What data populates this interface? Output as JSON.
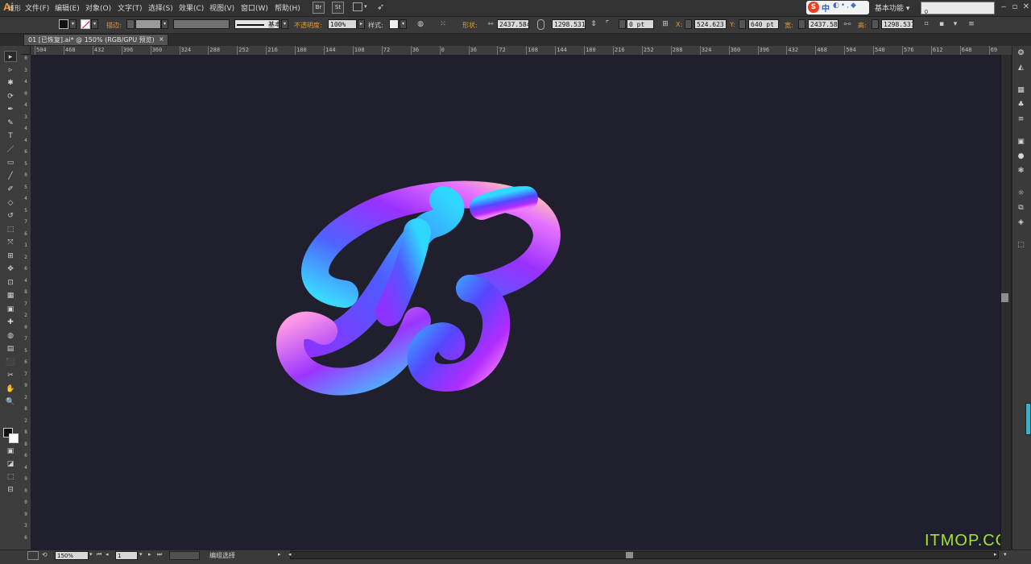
{
  "app": {
    "logo": "Ai"
  },
  "menu": [
    "文件(F)",
    "编辑(E)",
    "对象(O)",
    "文字(T)",
    "选择(S)",
    "效果(C)",
    "视图(V)",
    "窗口(W)",
    "帮助(H)"
  ],
  "menu_buttons": {
    "bridge": "Br",
    "stock": "St"
  },
  "ime": {
    "s": "S",
    "zh": "中",
    "rest": "◐•,◆"
  },
  "workspace_label": "基本功能",
  "control": {
    "object_type": "矩形",
    "stroke_label": "描边:",
    "stroke_style": "基本",
    "opacity_label": "不透明度:",
    "opacity_value": "100%",
    "style_label": "样式:",
    "shape_label": "形状:",
    "shape_w": "2437.584",
    "shape_h": "1298.531",
    "corner": "0 pt",
    "x_label": "X:",
    "x_value": "524.623",
    "y_label": "Y:",
    "y_value": "640 pt",
    "w_label": "宽:",
    "w_value": "2437.584",
    "h_label": "高:",
    "h_value": "1298.531"
  },
  "document_tab": {
    "title": "01 [已恢复].ai* @ 150% (RGB/GPU 预览)",
    "close": "×"
  },
  "ruler_h": [
    "504",
    "468",
    "432",
    "396",
    "360",
    "324",
    "288",
    "252",
    "216",
    "180",
    "144",
    "108",
    "72",
    "36",
    "0",
    "36",
    "72",
    "108",
    "144",
    "180",
    "216",
    "252",
    "288",
    "324",
    "360",
    "396",
    "432",
    "468",
    "504",
    "540",
    "576",
    "612",
    "648",
    "69"
  ],
  "ruler_v": [
    "0",
    "3",
    "4",
    "0",
    "4",
    "3",
    "4",
    "4",
    "6",
    "5",
    "0",
    "5",
    "4",
    "5",
    "7",
    "6",
    "1",
    "2",
    "6",
    "4",
    "8",
    "7",
    "2",
    "0",
    "7",
    "5",
    "6",
    "7",
    "9",
    "2",
    "8",
    "2",
    "8",
    "8",
    "6",
    "4",
    "9",
    "0",
    "0",
    "9",
    "3",
    "6"
  ],
  "tools": [
    "▸",
    "▹",
    "✱",
    "⟳",
    "✒",
    "✎",
    "T",
    "／",
    "▭",
    "╱",
    "✐",
    "◇",
    "↺",
    "⬚",
    "⤧",
    "⊞",
    "✥",
    "⊡",
    "▦",
    "▣",
    "✚",
    "◍",
    "▤",
    "⬛",
    "✂",
    "✋",
    "🔍"
  ],
  "panel_icons": [
    "❂",
    "◭",
    "▦",
    "♣",
    "≡",
    "▣",
    "●",
    "❃",
    "☼",
    "⧉",
    "◈",
    "⬚"
  ],
  "canvas": {
    "background": "#1f1f2e",
    "gradient_colors": [
      "#27d4ff",
      "#4a5cff",
      "#a02bff",
      "#e86bff",
      "#ffc2b0"
    ]
  },
  "status": {
    "zoom": "150%",
    "page": "1",
    "text": "编组选择"
  },
  "watermark": "ITMOP.COM"
}
